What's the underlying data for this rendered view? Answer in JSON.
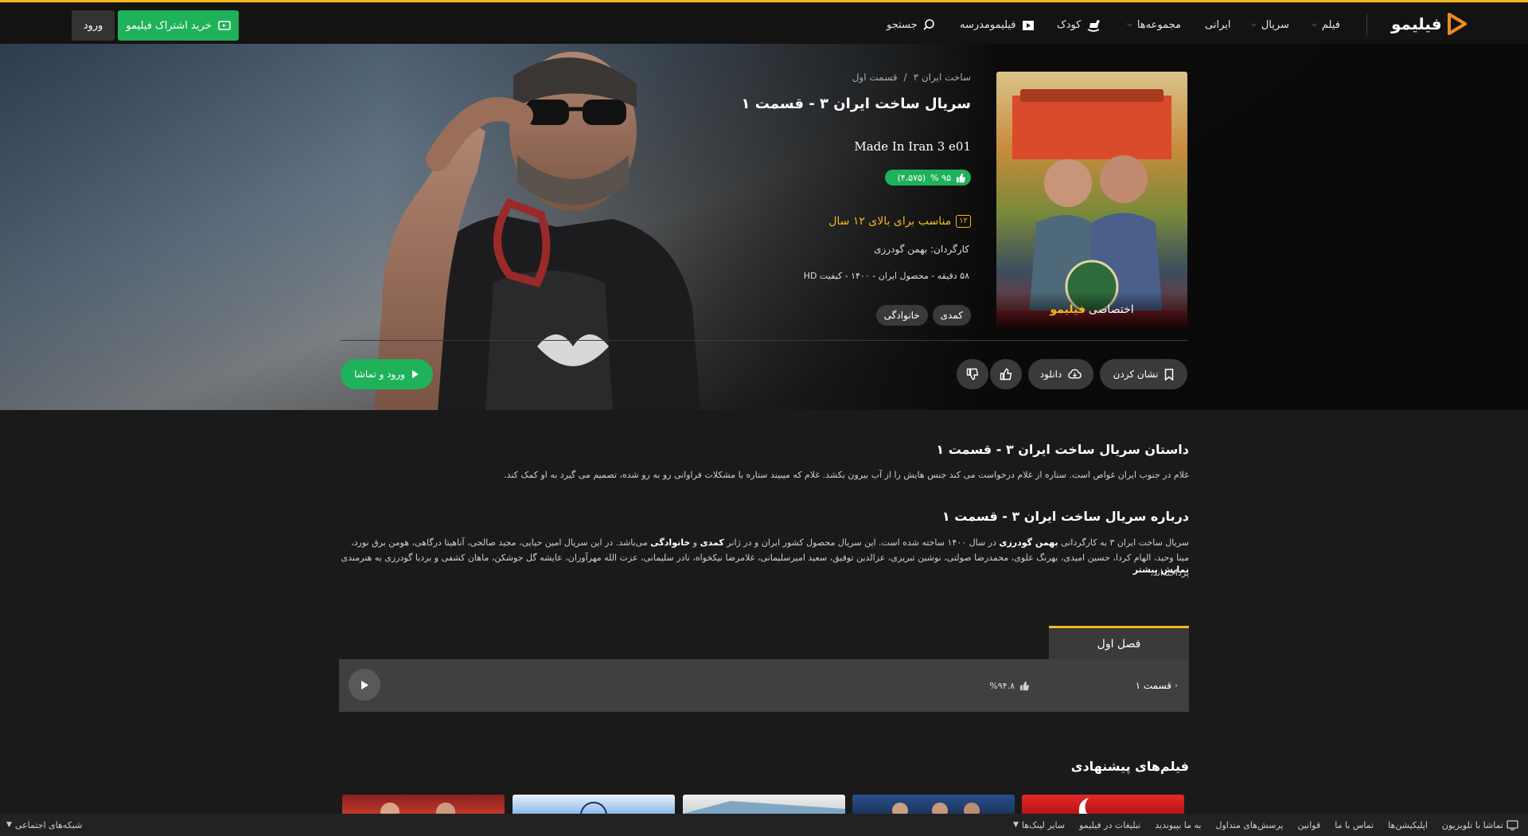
{
  "header": {
    "logo_text": "فیلیمو",
    "nav": {
      "film": "فیلم",
      "series": "سریال",
      "iranian": "ایرانی",
      "collections": "مجموعه‌ها",
      "kids": "کودک",
      "filimo_school": "فیلیمومدرسه",
      "search": "جستجو"
    },
    "subscribe_label": "خرید اشتراک فیلیمو",
    "login_label": "ورود"
  },
  "hero": {
    "breadcrumb": [
      "ساخت ایران ۳",
      "/",
      "قسمت اول"
    ],
    "title_fa": "سریال ساخت ایران ۳ - قسمت ۱",
    "title_en": "Made In Iran 3 e01",
    "rating_percent": "۹۵ %",
    "rating_count": "(۴،۵۷۵)",
    "age_badge": "۱۲",
    "age_text": "مناسب برای بالای ۱۲ سال",
    "director": "کارگردان: بهمن گودرزی",
    "meta": "۵۸ دقیقه - محصول ایران - ۱۴۰۰ - کیفیت HD",
    "genres": [
      "کمدی",
      "خانوادگی"
    ],
    "poster_badge_prefix": "اختصاصی",
    "poster_badge_brand": "فیلیمو",
    "bookmark_label": "نشان کردن",
    "download_label": "دانلود",
    "watch_label": "ورود و تماشا"
  },
  "story": {
    "heading": "داستان سریال ساخت ایران ۳ - قسمت ۱",
    "text": "غلام در جنوب ایران غواص است. ستاره از غلام درخواست می کند جنس هایش را از آب بیرون بکشد. غلام که میبیند ستاره با مشکلات فراوانی رو به رو شده، تصمیم می گیرد به او کمک کند."
  },
  "about": {
    "heading": "درباره سریال ساخت ایران ۳ - قسمت ۱",
    "part1": "سریال ساخت ایران ۳ به کارگردانی ",
    "director": "بهمن گودرزی",
    "part2": " در سال ۱۴۰۰ ساخته شده است. این سریال محصول کشور ایران و در ژانر ",
    "genre1": "کمدی",
    "part3": " و ",
    "genre2": "خانوادگی",
    "part4": " می‌باشد. در این سریال امین حیایی، مجید صالحی، آناهیتا درگاهی، هومن برق نورد، مینا وحید، الهام کردا، حسین امیدی، بهرنگ علوی، محمدرضا صولتی، نوشین تبریزی، عزالدین توفیق، سعید امیرسلیمانی، غلامرضا نیکخواه، نادر سلیمانی، عزت الله مهرآوران، عایشه گل جوشکن، ماهان کشفی و بردیا گودرزی به هنرمندی پرداخته‌اند.",
    "show_more": "نمایش بیشتر"
  },
  "episodes": {
    "season_tab": "فصل اول",
    "items": [
      {
        "title": "قسمت ۱",
        "rating": "%۹۴.۸"
      }
    ]
  },
  "suggestions": {
    "heading": "فیلم‌های پیشنهادی"
  },
  "footer": {
    "links": [
      "تماشا با تلویزیون",
      "اپلیکیشن‌ها",
      "تماس با ما",
      "قوانین",
      "پرسش‌های متداول",
      "به ما بپیوندید",
      "تبلیغات در فیلیمو",
      "سایر لینک‌ها"
    ],
    "social": "شبکه‌های اجتماعی"
  },
  "colors": {
    "accent": "#f4b81f",
    "green": "#1fb25a",
    "background": "#1a1a1a",
    "header": "#131313"
  }
}
